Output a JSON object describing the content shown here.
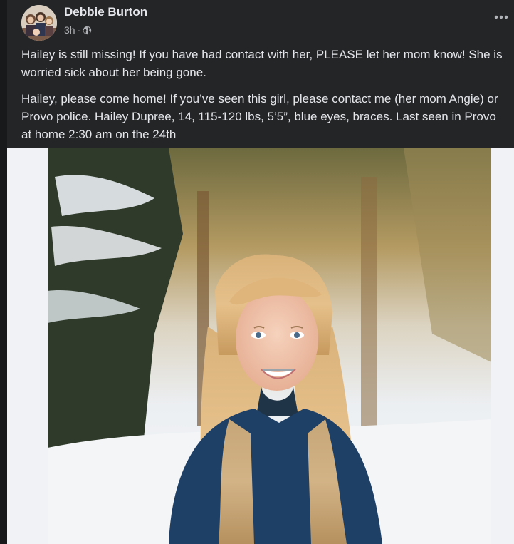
{
  "post": {
    "author": "Debbie Burton",
    "time": "3h",
    "separator": "·",
    "privacy_icon": "globe-icon",
    "more_icon": "more-options-icon",
    "paragraphs": [
      "Hailey is still missing! If you have had contact with her, PLEASE let her mom know! She is worried sick about her being gone.",
      "Hailey, please come home!  If you’ve seen this girl, please contact me (her mom Angie) or Provo police. Hailey Dupree, 14, 115-120 lbs, 5’5”, blue eyes, braces. Last seen in Provo at home 2:30 am on the 24th"
    ]
  },
  "colors": {
    "background": "#18191a",
    "card": "#242526",
    "primary_text": "#e4e6eb",
    "secondary_text": "#b0b3b8",
    "photo_frame": "#f0f2f5"
  }
}
